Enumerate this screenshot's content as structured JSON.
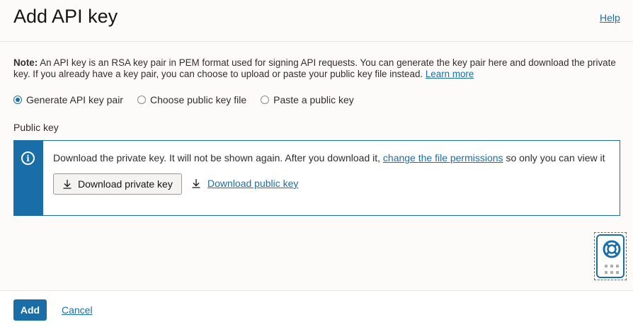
{
  "header": {
    "title": "Add API key",
    "help_label": "Help"
  },
  "note": {
    "bold_label": "Note:",
    "text": " An API key is an RSA key pair in PEM format used for signing API requests. You can generate the key pair here and download the private key. If you already have a key pair, you can choose to upload or paste your public key file instead. ",
    "link_label": "Learn more"
  },
  "options": {
    "items": [
      {
        "label": "Generate API key pair",
        "selected": true
      },
      {
        "label": "Choose public key file",
        "selected": false
      },
      {
        "label": "Paste a public key",
        "selected": false
      }
    ]
  },
  "public_key": {
    "label": "Public key",
    "info_text_before": "Download the private key. It will not be shown again. After you download it, ",
    "info_link": "change the file permissions",
    "info_text_after": " so only you can view it",
    "download_private_label": "Download private key",
    "download_public_label": "Download public key"
  },
  "footer": {
    "add_label": "Add",
    "cancel_label": "Cancel"
  },
  "colors": {
    "accent": "#1a6ea8",
    "background": "#fcfbfa",
    "text": "#312d2a"
  },
  "icons": {
    "info": "info-icon",
    "download": "download-icon",
    "help_widget": "lifebuoy-icon",
    "grid": "grid-dots-icon"
  }
}
